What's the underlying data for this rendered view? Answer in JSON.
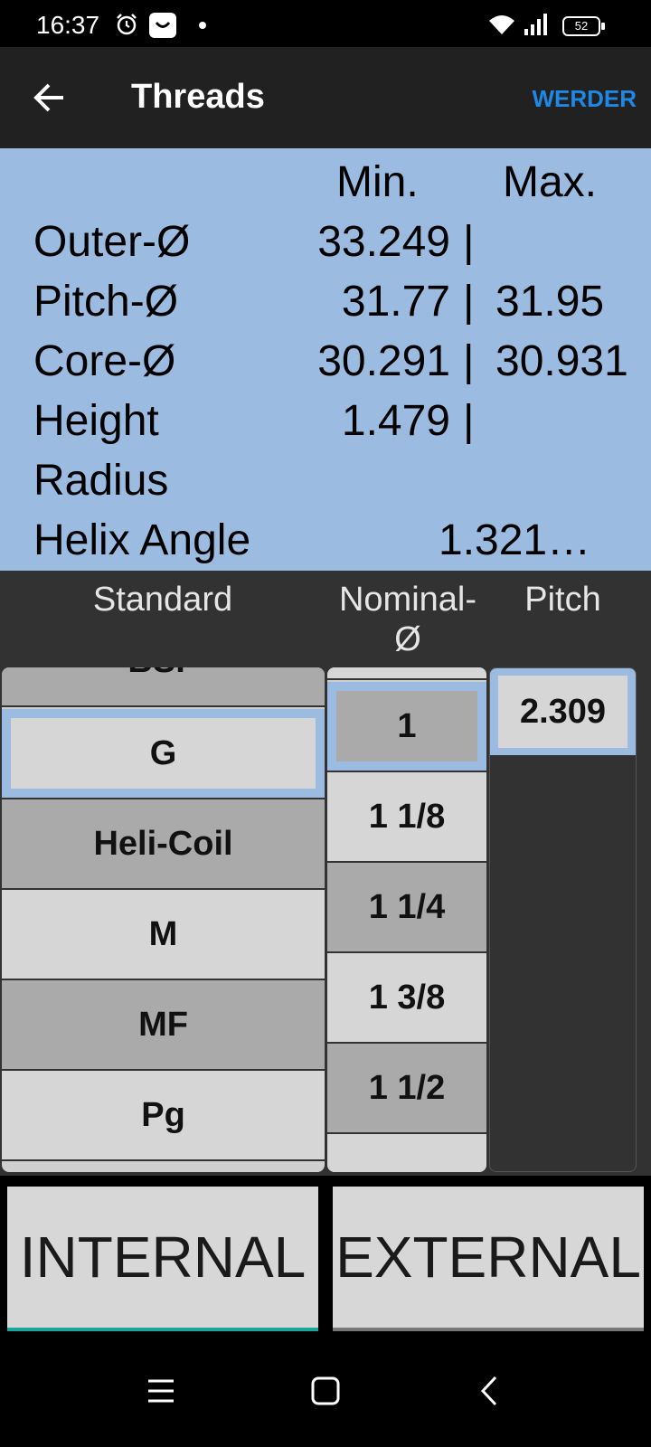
{
  "status_bar": {
    "time": "16:37",
    "battery": "52"
  },
  "app_bar": {
    "title": "Threads",
    "action": "WERDER"
  },
  "results": {
    "header_min": "Min.",
    "header_max": "Max.",
    "rows": [
      {
        "label": "Outer-Ø",
        "min": "33.249",
        "sep": "|",
        "max": ""
      },
      {
        "label": "Pitch-Ø",
        "min": "31.77",
        "sep": "|",
        "max": "31.95"
      },
      {
        "label": "Core-Ø",
        "min": "30.291",
        "sep": "|",
        "max": "30.931"
      },
      {
        "label": "Height",
        "min": "1.479",
        "sep": "|",
        "max": ""
      },
      {
        "label": "Radius",
        "min": "",
        "sep": "",
        "max": ""
      }
    ],
    "helix": {
      "label": "Helix Angle",
      "value": "1.321…"
    }
  },
  "columns": {
    "standard": "Standard",
    "nominal": "Nominal-Ø",
    "pitch": "Pitch"
  },
  "standards": [
    "BSP",
    "G",
    "Heli-Coil",
    "M",
    "MF",
    "Pg"
  ],
  "nominals": [
    "1",
    "1 1/8",
    "1 1/4",
    "1 3/8",
    "1 1/2"
  ],
  "pitch": {
    "selected": "2.309"
  },
  "buttons": {
    "internal": "INTERNAL",
    "external": "EXTERNAL"
  },
  "colors": {
    "panel": "#9bbbe0",
    "accent": "#1e88e5",
    "active_underline": "#1aa69a"
  }
}
